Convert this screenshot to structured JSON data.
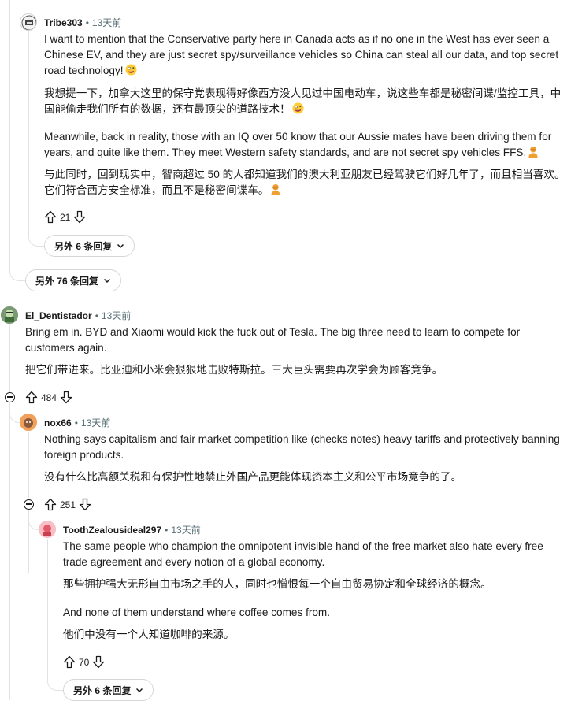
{
  "thread": {
    "c1": {
      "author": "Tribe303",
      "time": "13天前",
      "p1": "I want to mention that the Conservative party here in Canada acts as if no one in the West has ever seen a Chinese EV, and they are just secret spy/surveillance vehicles so China can steal all our data, and top secret road technology!",
      "p1_zh": "我想提一下，加拿大这里的保守党表现得好像西方没人见过中国电动车，说这些车都是秘密间谍/监控工具，中国能偷走我们所有的数据，还有最顶尖的道路技术！",
      "p2": "Meanwhile, back in reality, those with an IQ over 50 know that our Aussie mates have been driving them for years, and quite like them. They meet Western safety standards, and are not secret spy vehicles FFS.",
      "p2_zh": "与此同时，回到现实中，智商超过 50 的人都知道我们的澳大利亚朋友已经驾驶它们好几年了，而且相当喜欢。它们符合西方安全标准，而且不是秘密间谍车。",
      "votes": "21",
      "more_replies": "另外 6 条回复"
    },
    "more_top": "另外 76 条回复",
    "c2": {
      "author": "El_Dentistador",
      "time": "13天前",
      "p1": "Bring em in. BYD and Xiaomi would kick the fuck out of Tesla. The big three need to learn to compete for customers again.",
      "p1_zh": "把它们带进来。比亚迪和小米会狠狠地击败特斯拉。三大巨头需要再次学会为顾客竞争。",
      "votes": "484"
    },
    "c3": {
      "author": "nox66",
      "time": "13天前",
      "p1": "Nothing says capitalism and fair market competition like (checks notes) heavy tariffs and protectively banning foreign products.",
      "p1_zh": "没有什么比高额关税和有保护性地禁止外国产品更能体现资本主义和公平市场竞争的了。",
      "votes": "251"
    },
    "c4": {
      "author": "ToothZealousideal297",
      "time": "13天前",
      "p1": "The same people who champion the omnipotent invisible hand of the free market also hate every free trade agreement and every notion of a global economy.",
      "p1_zh": "那些拥护强大无形自由市场之手的人，同时也憎恨每一个自由贸易协定和全球经济的概念。",
      "p2": "And none of them understand where coffee comes from.",
      "p2_zh": "他们中没有一个人知道咖啡的来源。",
      "votes": "70",
      "more_replies": "另外 6 条回复"
    }
  },
  "icons": {
    "upvote": "arrow-up-icon",
    "downvote": "arrow-down-icon",
    "collapse": "collapse-minus-icon",
    "chevron": "chevron-down-icon",
    "emoji1": "crazy-face-emoji",
    "emoji2": "facepalm-emoji"
  }
}
